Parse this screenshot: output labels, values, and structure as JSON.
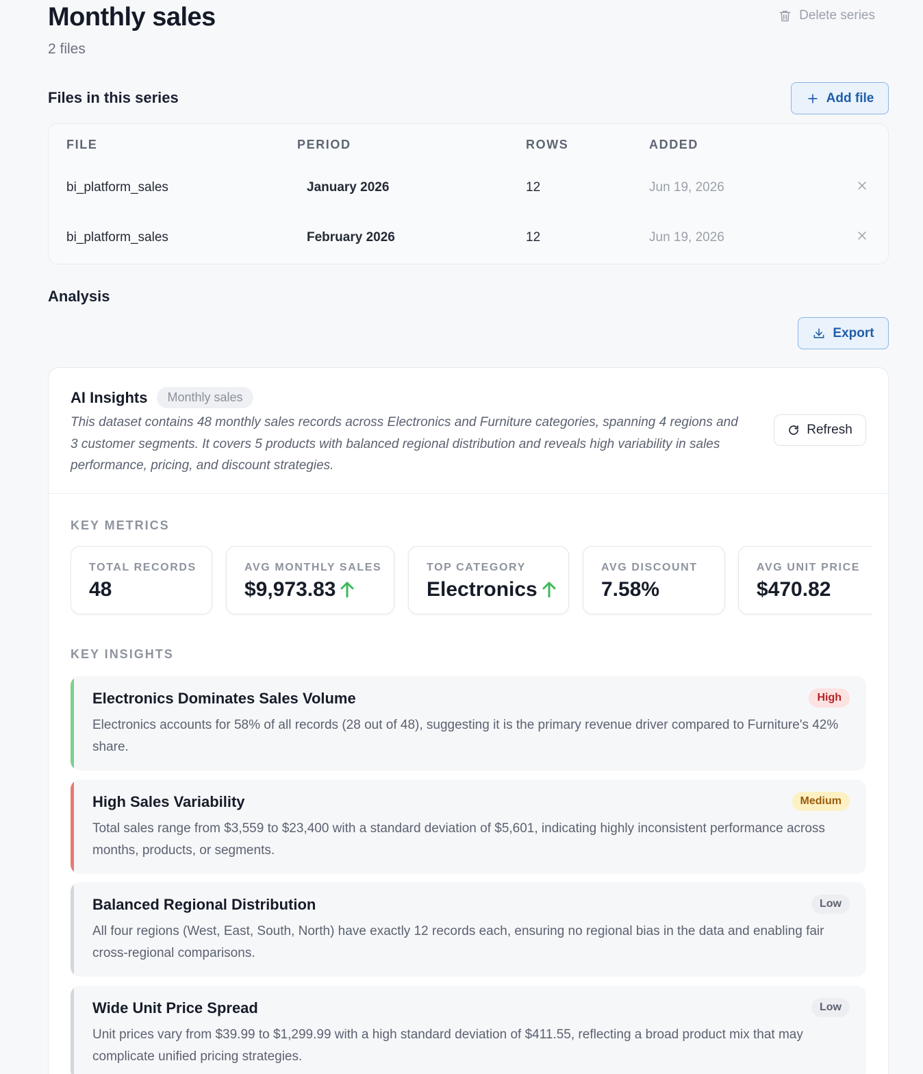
{
  "header": {
    "title": "Monthly sales",
    "subtitle": "2 files",
    "delete_label": "Delete series"
  },
  "files_section": {
    "title": "Files in this series",
    "add_label": "Add file",
    "columns": [
      "FILE",
      "PERIOD",
      "ROWS",
      "ADDED"
    ],
    "rows": [
      {
        "file": "bi_platform_sales",
        "period": "January 2026",
        "rows": "12",
        "added": "Jun 19, 2026"
      },
      {
        "file": "bi_platform_sales",
        "period": "February 2026",
        "rows": "12",
        "added": "Jun 19, 2026"
      }
    ]
  },
  "analysis": {
    "title": "Analysis",
    "export_label": "Export",
    "ai_insights": {
      "title": "AI Insights",
      "chip": "Monthly sales",
      "summary": "This dataset contains 48 monthly sales records across Electronics and Furniture categories, spanning 4 regions and 3 customer segments. It covers 5 products with balanced regional distribution and reveals high variability in sales performance, pricing, and discount strategies.",
      "refresh_label": "Refresh"
    },
    "key_metrics_label": "KEY METRICS",
    "metrics": [
      {
        "label": "TOTAL RECORDS",
        "value": "48"
      },
      {
        "label": "AVG MONTHLY SALES",
        "value": "$9,973.83",
        "trend": "up"
      },
      {
        "label": "TOP CATEGORY",
        "value": "Electronics",
        "trend": "up"
      },
      {
        "label": "AVG DISCOUNT",
        "value": "7.58%"
      },
      {
        "label": "AVG UNIT PRICE",
        "value": "$470.82"
      }
    ],
    "key_insights_label": "KEY INSIGHTS",
    "insights": [
      {
        "title": "Electronics Dominates Sales Volume",
        "body": "Electronics accounts for 58% of all records (28 out of 48), suggesting it is the primary revenue driver compared to Furniture's 42% share.",
        "severity": "High",
        "accent_color": "#7dd08a",
        "badge_bg": "#fde2e2",
        "badge_fg": "#b42323"
      },
      {
        "title": "High Sales Variability",
        "body": "Total sales range from $3,559 to $23,400 with a standard deviation of $5,601, indicating highly inconsistent performance across months, products, or segments.",
        "severity": "Medium",
        "accent_color": "#e57b73",
        "badge_bg": "#fdf1c4",
        "badge_fg": "#9a5b0c"
      },
      {
        "title": "Balanced Regional Distribution",
        "body": "All four regions (West, East, South, North) have exactly 12 records each, ensuring no regional bias in the data and enabling fair cross-regional comparisons.",
        "severity": "Low",
        "accent_color": "#d3d6dc",
        "badge_bg": "#eceef1",
        "badge_fg": "#5b6170"
      },
      {
        "title": "Wide Unit Price Spread",
        "body": "Unit prices vary from $39.99 to $1,299.99 with a high standard deviation of $411.55, reflecting a broad product mix that may complicate unified pricing strategies.",
        "severity": "Low",
        "accent_color": "#d3d6dc",
        "badge_bg": "#eceef1",
        "badge_fg": "#5b6170"
      }
    ],
    "trend_color": "#3fb95a"
  }
}
